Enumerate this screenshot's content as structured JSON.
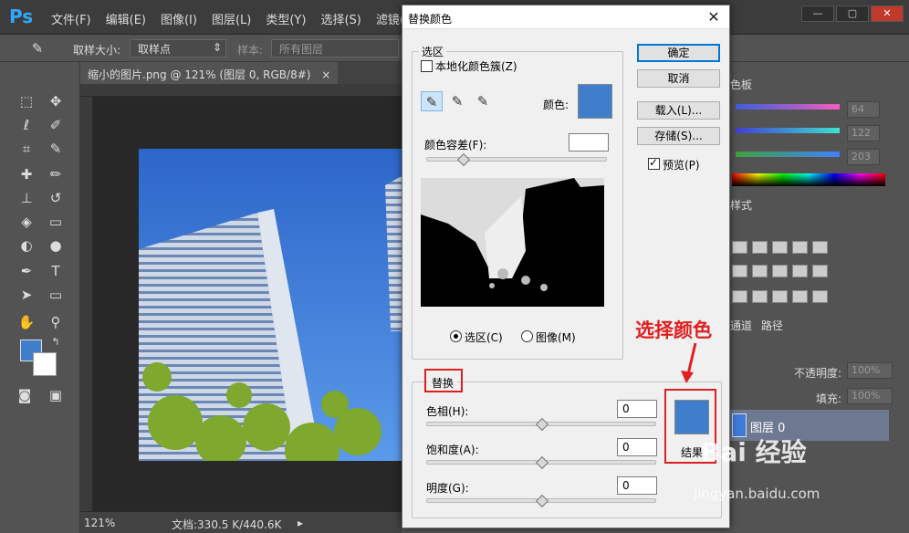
{
  "app": {
    "logo": "Ps",
    "menu": [
      "文件(F)",
      "编辑(E)",
      "图像(I)",
      "图层(L)",
      "类型(Y)",
      "选择(S)",
      "滤镜(T)"
    ],
    "window_buttons": [
      "—",
      "▢",
      "✕"
    ]
  },
  "options_bar": {
    "sample_size_label": "取样大小:",
    "sample_size_value": "取样点",
    "sample_label": "样本:",
    "sample_value": "所有图层"
  },
  "document": {
    "tab_title": "缩小的图片.png @ 121% (图层 0, RGB/8#)",
    "tab_close": "×",
    "zoom": "121%",
    "doc_size": "文档:330.5 K/440.6K"
  },
  "right_panel": {
    "color_tab_fragment": "色板",
    "styles_tab_fragment": "样式",
    "channels_tab_fragment": "通道",
    "paths_tab": "路径",
    "slider_values": [
      "64",
      "122",
      "203"
    ],
    "opacity_label": "不透明度:",
    "opacity_value": "100%",
    "fill_label": "填充:",
    "fill_value": "100%",
    "layer_name": "图层 0"
  },
  "dialog": {
    "title": "替换颜色",
    "close": "✕",
    "selection_group": "选区",
    "localized_clusters": "本地化颜色簇(Z)",
    "color_label": "颜色:",
    "fuzziness_label": "颜色容差(F):",
    "fuzziness_value": "",
    "radio_selection": "选区(C)",
    "radio_image": "图像(M)",
    "replace_group": "替换",
    "hue_label": "色相(H):",
    "hue_value": "0",
    "saturation_label": "饱和度(A):",
    "saturation_value": "0",
    "lightness_label": "明度(G):",
    "lightness_value": "0",
    "result_label": "结果",
    "buttons": {
      "ok": "确定",
      "cancel": "取消",
      "load": "载入(L)...",
      "save": "存储(S)...",
      "preview": "预览(P)"
    },
    "preview_checked": true,
    "localized_checked": false,
    "selected_color": "#3f7ecb"
  },
  "annotation": {
    "text": "选择颜色",
    "color": "#e02020"
  },
  "watermark": {
    "brand": "Bai 经验",
    "url": "jingyan.baidu.com"
  }
}
